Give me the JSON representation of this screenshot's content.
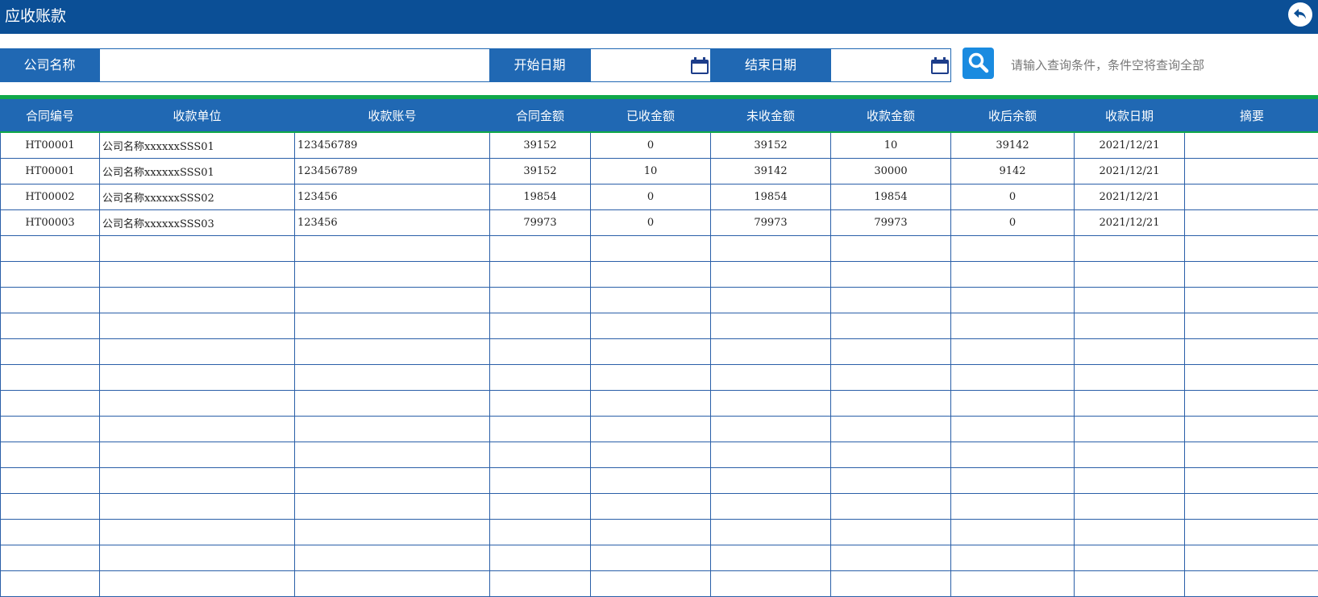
{
  "header": {
    "title": "应收账款",
    "back_icon": "back-arrow-icon"
  },
  "filters": {
    "company_label": "公司名称",
    "company_value": "",
    "start_label": "开始日期",
    "start_value": "",
    "end_label": "结束日期",
    "end_value": "",
    "hint": "请输入查询条件，条件空将查询全部"
  },
  "table": {
    "columns": [
      "合同编号",
      "收款单位",
      "收款账号",
      "合同金额",
      "已收金额",
      "未收金额",
      "收款金额",
      "收后余额",
      "收款日期",
      "摘要"
    ],
    "rows": [
      [
        "HT00001",
        "公司名称xxxxxxSSS01",
        "123456789",
        "39152",
        "0",
        "39152",
        "10",
        "39142",
        "2021/12/21",
        ""
      ],
      [
        "HT00001",
        "公司名称xxxxxxSSS01",
        "123456789",
        "39152",
        "10",
        "39142",
        "30000",
        "9142",
        "2021/12/21",
        ""
      ],
      [
        "HT00002",
        "公司名称xxxxxxSSS02",
        "123456",
        "19854",
        "0",
        "19854",
        "19854",
        "0",
        "2021/12/21",
        ""
      ],
      [
        "HT00003",
        "公司名称xxxxxxSSS03",
        "123456",
        "79973",
        "0",
        "79973",
        "79973",
        "0",
        "2021/12/21",
        ""
      ]
    ]
  },
  "colors": {
    "title_bar": "#0b4f96",
    "label_bg": "#2068b3",
    "accent_green": "#10a84a",
    "search_btn": "#1a8be0"
  }
}
